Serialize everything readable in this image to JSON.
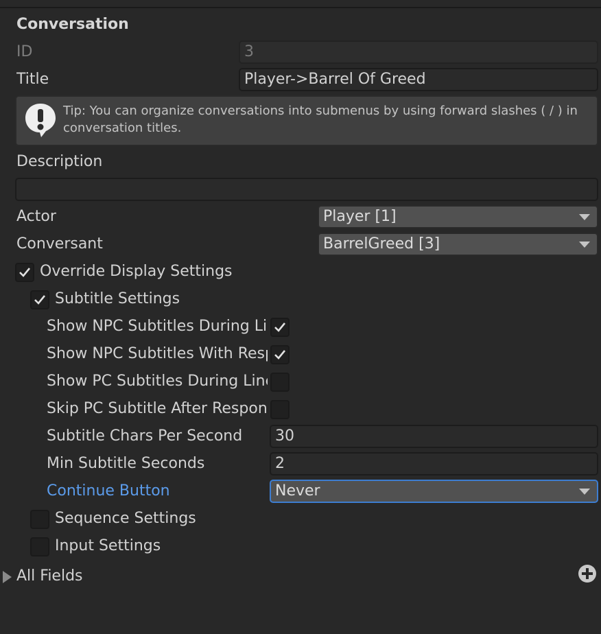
{
  "section_title": "Conversation",
  "id": {
    "label": "ID",
    "value": "3"
  },
  "title": {
    "label": "Title",
    "value": "Player->Barrel Of Greed"
  },
  "tip": {
    "text": "Tip: You can organize conversations into submenus by using forward slashes ( / ) in conversation titles."
  },
  "description": {
    "label": "Description",
    "value": ""
  },
  "actor": {
    "label": "Actor",
    "value": "Player [1]"
  },
  "conversant": {
    "label": "Conversant",
    "value": "BarrelGreed [3]"
  },
  "override_display": {
    "label": "Override Display Settings",
    "checked": true
  },
  "subtitle_settings": {
    "label": "Subtitle Settings",
    "checked": true,
    "show_npc_during_line": {
      "label": "Show NPC Subtitles During Line",
      "checked": true
    },
    "show_npc_with_responses": {
      "label": "Show NPC Subtitles With Responses",
      "checked": true
    },
    "show_pc_during_line": {
      "label": "Show PC Subtitles During Line",
      "checked": false
    },
    "skip_pc_after_response": {
      "label": "Skip PC Subtitle After Response Menu",
      "checked": false
    },
    "chars_per_second": {
      "label": "Subtitle Chars Per Second",
      "value": "30"
    },
    "min_seconds": {
      "label": "Min Subtitle Seconds",
      "value": "2"
    },
    "continue_button": {
      "label": "Continue Button",
      "value": "Never"
    }
  },
  "sequence_settings": {
    "label": "Sequence Settings",
    "checked": false
  },
  "input_settings": {
    "label": "Input Settings",
    "checked": false
  },
  "all_fields": {
    "label": "All Fields"
  },
  "colors": {
    "background": "#282828",
    "accent": "#3d7dd1",
    "link_label": "#5b9bea"
  }
}
